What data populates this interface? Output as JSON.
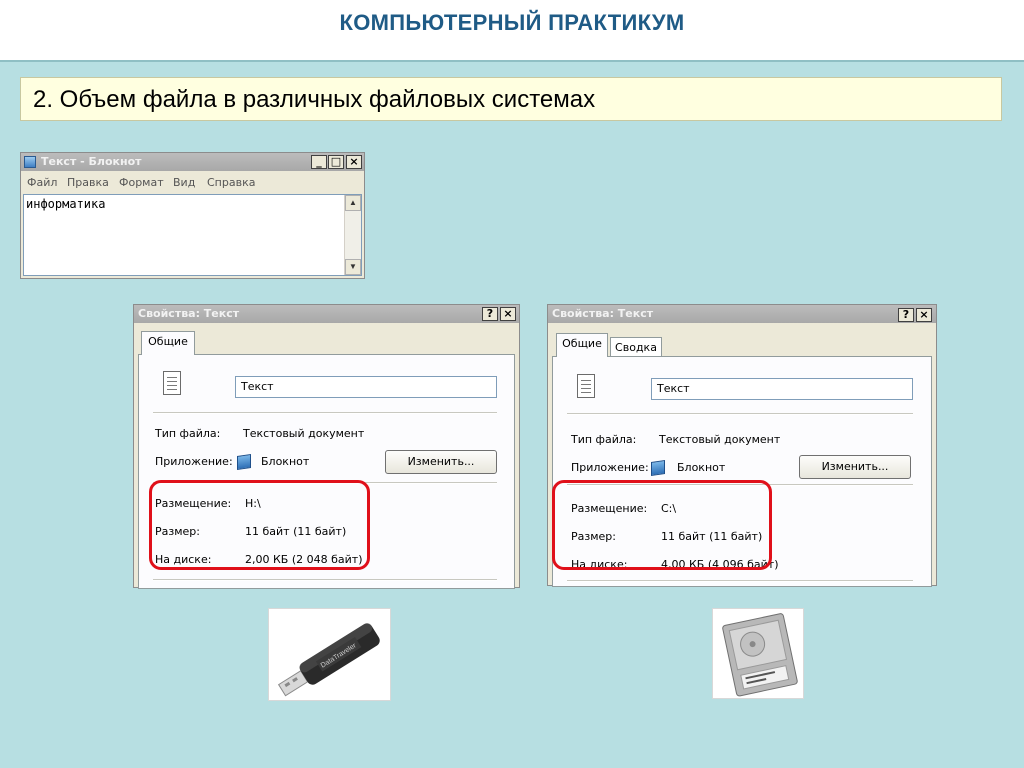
{
  "header": {
    "title": "КОМПЬЮТЕРНЫЙ ПРАКТИКУМ"
  },
  "subtitle": "2. Объем файла в различных файловых системах",
  "notepad": {
    "title": "Текст - Блокнот",
    "menu": [
      "Файл",
      "Правка",
      "Формат",
      "Вид",
      "Справка"
    ],
    "content": "информатика",
    "buttons": {
      "minimize": "_",
      "maximize": "□",
      "close": "×"
    }
  },
  "dialog_left": {
    "title": "Свойства: Текст",
    "help_btn": "?",
    "close_btn": "×",
    "tabs": [
      "Общие"
    ],
    "name_value": "Текст",
    "file_type_label": "Тип файла:",
    "file_type_value": "Текстовый документ",
    "app_label": "Приложение:",
    "app_value": "Блокнот",
    "change_button": "Изменить...",
    "location_label": "Размещение:",
    "location_value": "H:\\",
    "size_label": "Размер:",
    "size_value": "11 байт (11 байт)",
    "disk_label": "На диске:",
    "disk_value": "2,00 КБ (2 048 байт)"
  },
  "dialog_right": {
    "title": "Свойства: Текст",
    "help_btn": "?",
    "close_btn": "×",
    "tabs": [
      "Общие",
      "Сводка"
    ],
    "name_value": "Текст",
    "file_type_label": "Тип файла:",
    "file_type_value": "Текстовый документ",
    "app_label": "Приложение:",
    "app_value": "Блокнот",
    "change_button": "Изменить...",
    "location_label": "Размещение:",
    "location_value": "C:\\",
    "size_label": "Размер:",
    "size_value": "11 байт (11 байт)",
    "disk_label": "На диске:",
    "disk_value": "4,00 КБ (4 096 байт)"
  },
  "images": {
    "flash_drive_icon": "usb-flash-drive",
    "flash_drive_brand": "DataTraveler",
    "hard_drive_icon": "hard-disk-drive"
  },
  "colors": {
    "background": "#b7dfe2",
    "title": "#1f5b86",
    "highlight": "#e0101a",
    "subtitle_box": "#ffffe0"
  }
}
